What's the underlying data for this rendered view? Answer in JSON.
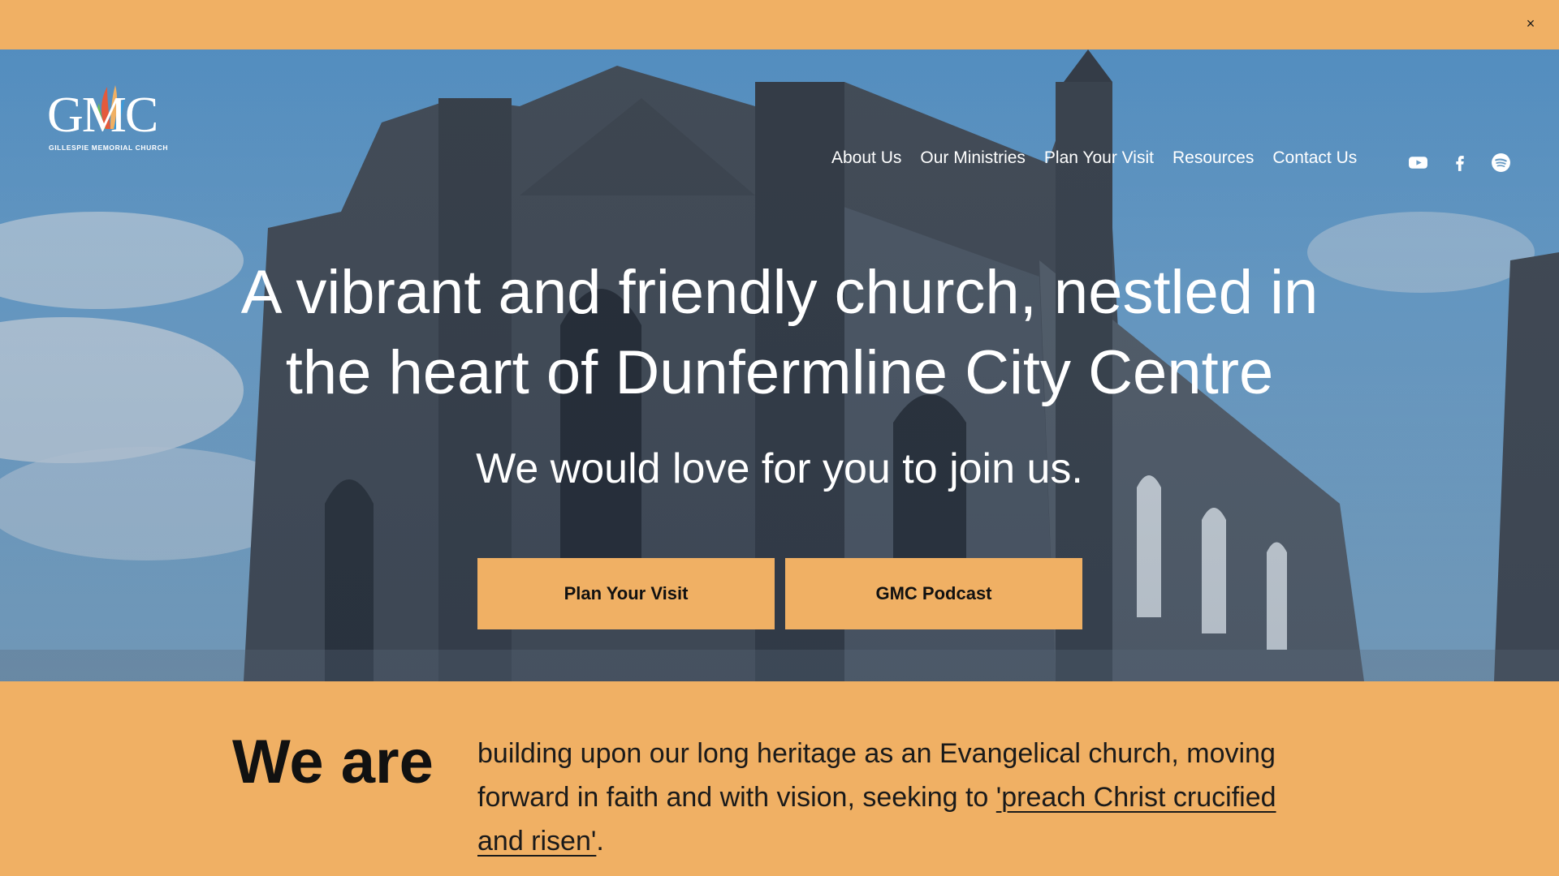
{
  "announcement": {
    "close_label": "×"
  },
  "logo": {
    "mark": "GMC",
    "subtitle": "GILLESPIE MEMORIAL CHURCH"
  },
  "nav": {
    "items": [
      "About Us",
      "Our Ministries",
      "Plan Your Visit",
      "Resources",
      "Contact Us"
    ]
  },
  "social": [
    "youtube-icon",
    "facebook-icon",
    "spotify-icon"
  ],
  "hero": {
    "headline_line1": "A vibrant and friendly church, nestled in",
    "headline_line2": "the heart of Dunfermline City Centre",
    "tagline": "We would love for you to join us.",
    "buttons": {
      "visit": "Plan Your Visit",
      "podcast": "GMC Podcast"
    }
  },
  "about": {
    "heading": "We are",
    "text_before": "building upon our long heritage as an Evangelical church, moving forward in faith and with vision,  seeking  to ",
    "link": "'preach Christ crucified and risen'",
    "text_after": "."
  },
  "colors": {
    "accent": "#f0b064",
    "sky": "#6aa8d8",
    "stone": "#3f4a55"
  }
}
